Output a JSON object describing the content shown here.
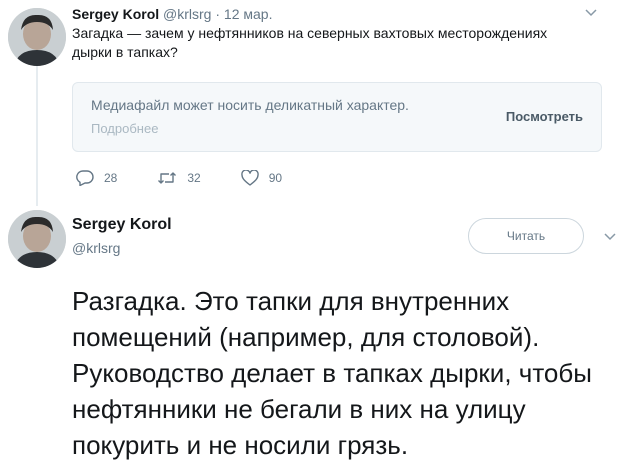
{
  "tweet1": {
    "author_name": "Sergey Korol",
    "handle": "@krlsrg",
    "separator": "·",
    "date": "12 мар.",
    "text": "Загадка — зачем у нефтянников на северных вахтовых месторождениях дырки в тапках?",
    "sensitive_media": {
      "notice": "Медиафайл может носить деликатный характер.",
      "more_link": "Подробнее",
      "view_button": "Посмотреть"
    },
    "actions": {
      "replies": "28",
      "retweets": "32",
      "likes": "90"
    }
  },
  "tweet2": {
    "author_name": "Sergey Korol",
    "handle": "@krlsrg",
    "follow_button": "Читать",
    "text": "Разгадка. Это тапки для внутренних помещений (например, для столовой). Руководство делает в тапках дырки, чтобы нефтянники не бегали в них на улицу покурить и не носили грязь."
  },
  "icons": {
    "reply": "reply-icon",
    "retweet": "retweet-icon",
    "like": "heart-icon",
    "menu": "chevron-down-icon"
  },
  "colors": {
    "text": "#14171a",
    "secondary": "#657786",
    "border": "#e1e8ed"
  }
}
